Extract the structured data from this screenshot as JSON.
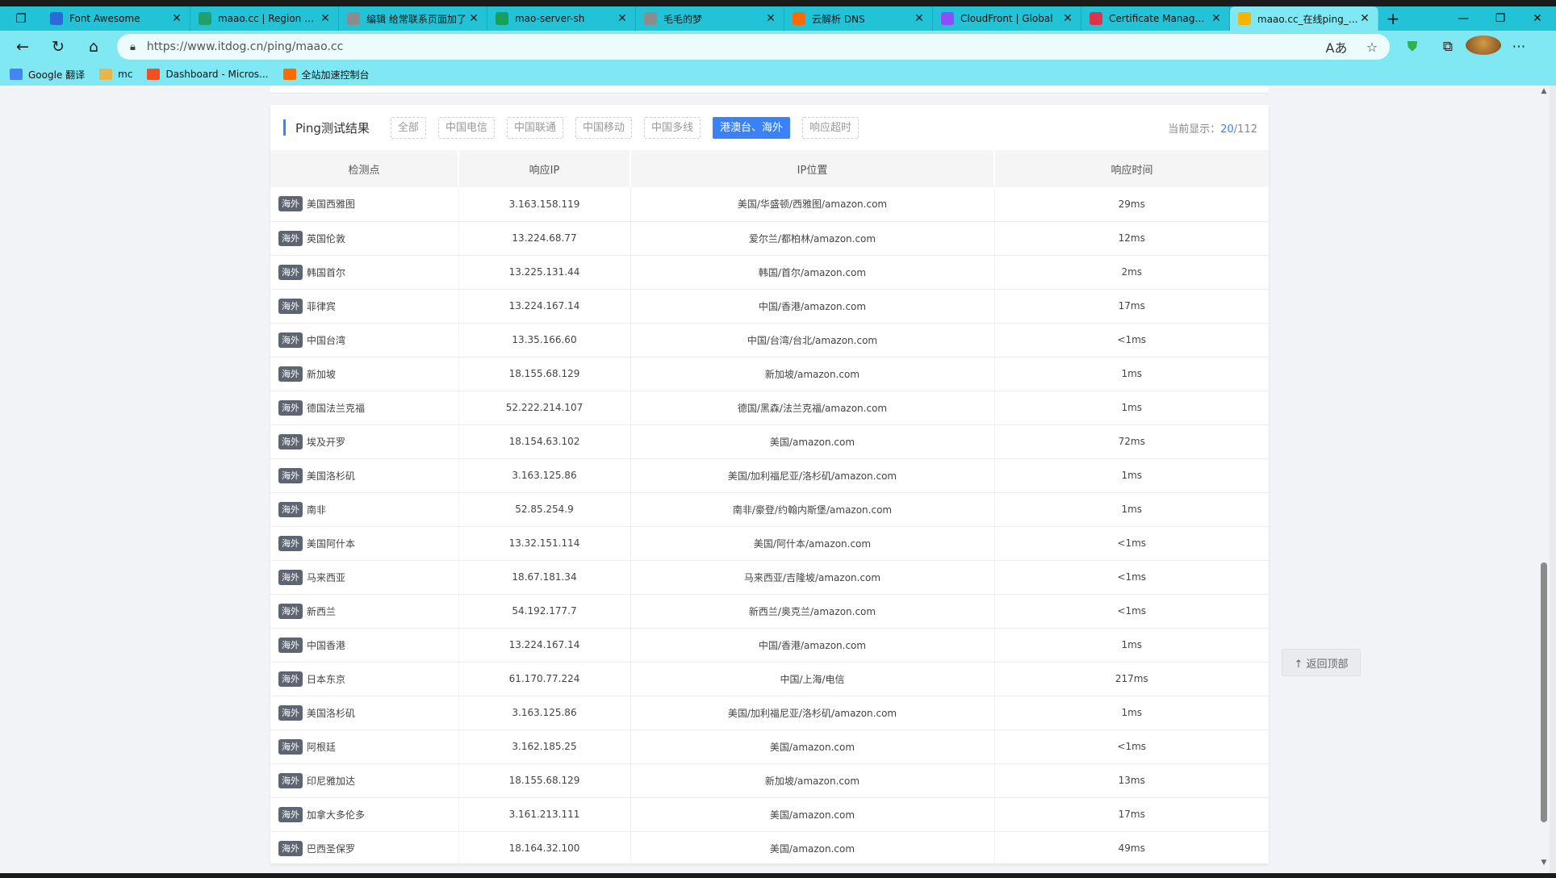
{
  "browser": {
    "tabs": [
      {
        "title": "Font Awesome",
        "favicon": "font-awesome-icon",
        "color": "#2b6ad8"
      },
      {
        "title": "maao.cc | Region Selector",
        "favicon": "region-icon",
        "color": "#22a06b"
      },
      {
        "title": "编辑 给常联系页面加了",
        "favicon": "cat-icon",
        "color": "#8c8c8c"
      },
      {
        "title": "mao-server-sh",
        "favicon": "shield-icon",
        "color": "#18a058"
      },
      {
        "title": "毛毛的梦",
        "favicon": "cat-icon",
        "color": "#8c8c8c"
      },
      {
        "title": "云解析 DNS",
        "favicon": "aliyun-icon",
        "color": "#ff6a00"
      },
      {
        "title": "CloudFront | Global",
        "favicon": "cloudfront-icon",
        "color": "#8c4fff"
      },
      {
        "title": "Certificate Manager | us",
        "favicon": "certificate-icon",
        "color": "#dd344c"
      },
      {
        "title": "maao.cc_在线ping_多地",
        "favicon": "itdog-icon",
        "color": "#f5b400",
        "active": true
      }
    ],
    "url": "https://www.itdog.cn/ping/maao.cc",
    "bookmarks": [
      {
        "label": "Google 翻译",
        "icon": "google-translate-icon"
      },
      {
        "label": "mc",
        "icon": "folder-icon"
      },
      {
        "label": "Dashboard - Micros...",
        "icon": "microsoft-icon"
      },
      {
        "label": "全站加速控制台",
        "icon": "aliyun-icon"
      }
    ]
  },
  "results": {
    "title": "Ping测试结果",
    "filters": [
      {
        "label": "全部",
        "active": false
      },
      {
        "label": "中国电信",
        "active": false
      },
      {
        "label": "中国联通",
        "active": false
      },
      {
        "label": "中国移动",
        "active": false
      },
      {
        "label": "中国多线",
        "active": false
      },
      {
        "label": "港澳台、海外",
        "active": true
      },
      {
        "label": "响应超时",
        "active": false
      }
    ],
    "count_label": "当前显示：",
    "count_current": "20",
    "count_total": "/112",
    "columns": [
      "检测点",
      "响应IP",
      "IP位置",
      "响应时间"
    ],
    "tag": "海外",
    "rows": [
      {
        "node": "美国西雅图",
        "ip": "3.163.158.119",
        "location": "美国/华盛顿/西雅图/amazon.com",
        "time": "29ms"
      },
      {
        "node": "英国伦敦",
        "ip": "13.224.68.77",
        "location": "爱尔兰/都柏林/amazon.com",
        "time": "12ms"
      },
      {
        "node": "韩国首尔",
        "ip": "13.225.131.44",
        "location": "韩国/首尔/amazon.com",
        "time": "2ms"
      },
      {
        "node": "菲律宾",
        "ip": "13.224.167.14",
        "location": "中国/香港/amazon.com",
        "time": "17ms"
      },
      {
        "node": "中国台湾",
        "ip": "13.35.166.60",
        "location": "中国/台湾/台北/amazon.com",
        "time": "<1ms"
      },
      {
        "node": "新加坡",
        "ip": "18.155.68.129",
        "location": "新加坡/amazon.com",
        "time": "1ms"
      },
      {
        "node": "德国法兰克福",
        "ip": "52.222.214.107",
        "location": "德国/黑森/法兰克福/amazon.com",
        "time": "1ms"
      },
      {
        "node": "埃及开罗",
        "ip": "18.154.63.102",
        "location": "美国/amazon.com",
        "time": "72ms"
      },
      {
        "node": "美国洛杉矶",
        "ip": "3.163.125.86",
        "location": "美国/加利福尼亚/洛杉矶/amazon.com",
        "time": "1ms"
      },
      {
        "node": "南非",
        "ip": "52.85.254.9",
        "location": "南非/豪登/约翰内斯堡/amazon.com",
        "time": "1ms"
      },
      {
        "node": "美国阿什本",
        "ip": "13.32.151.114",
        "location": "美国/阿什本/amazon.com",
        "time": "<1ms"
      },
      {
        "node": "马来西亚",
        "ip": "18.67.181.34",
        "location": "马来西亚/吉隆坡/amazon.com",
        "time": "<1ms"
      },
      {
        "node": "新西兰",
        "ip": "54.192.177.7",
        "location": "新西兰/奥克兰/amazon.com",
        "time": "<1ms"
      },
      {
        "node": "中国香港",
        "ip": "13.224.167.14",
        "location": "中国/香港/amazon.com",
        "time": "1ms"
      },
      {
        "node": "日本东京",
        "ip": "61.170.77.224",
        "location": "中国/上海/电信",
        "time": "217ms"
      },
      {
        "node": "美国洛杉矶",
        "ip": "3.163.125.86",
        "location": "美国/加利福尼亚/洛杉矶/amazon.com",
        "time": "1ms"
      },
      {
        "node": "阿根廷",
        "ip": "3.162.185.25",
        "location": "美国/amazon.com",
        "time": "<1ms"
      },
      {
        "node": "印尼雅加达",
        "ip": "18.155.68.129",
        "location": "新加坡/amazon.com",
        "time": "13ms"
      },
      {
        "node": "加拿大多伦多",
        "ip": "3.161.213.111",
        "location": "美国/amazon.com",
        "time": "17ms"
      },
      {
        "node": "巴西圣保罗",
        "ip": "18.164.32.100",
        "location": "美国/amazon.com",
        "time": "49ms"
      }
    ]
  },
  "back_to_top": "↑ 返回顶部"
}
